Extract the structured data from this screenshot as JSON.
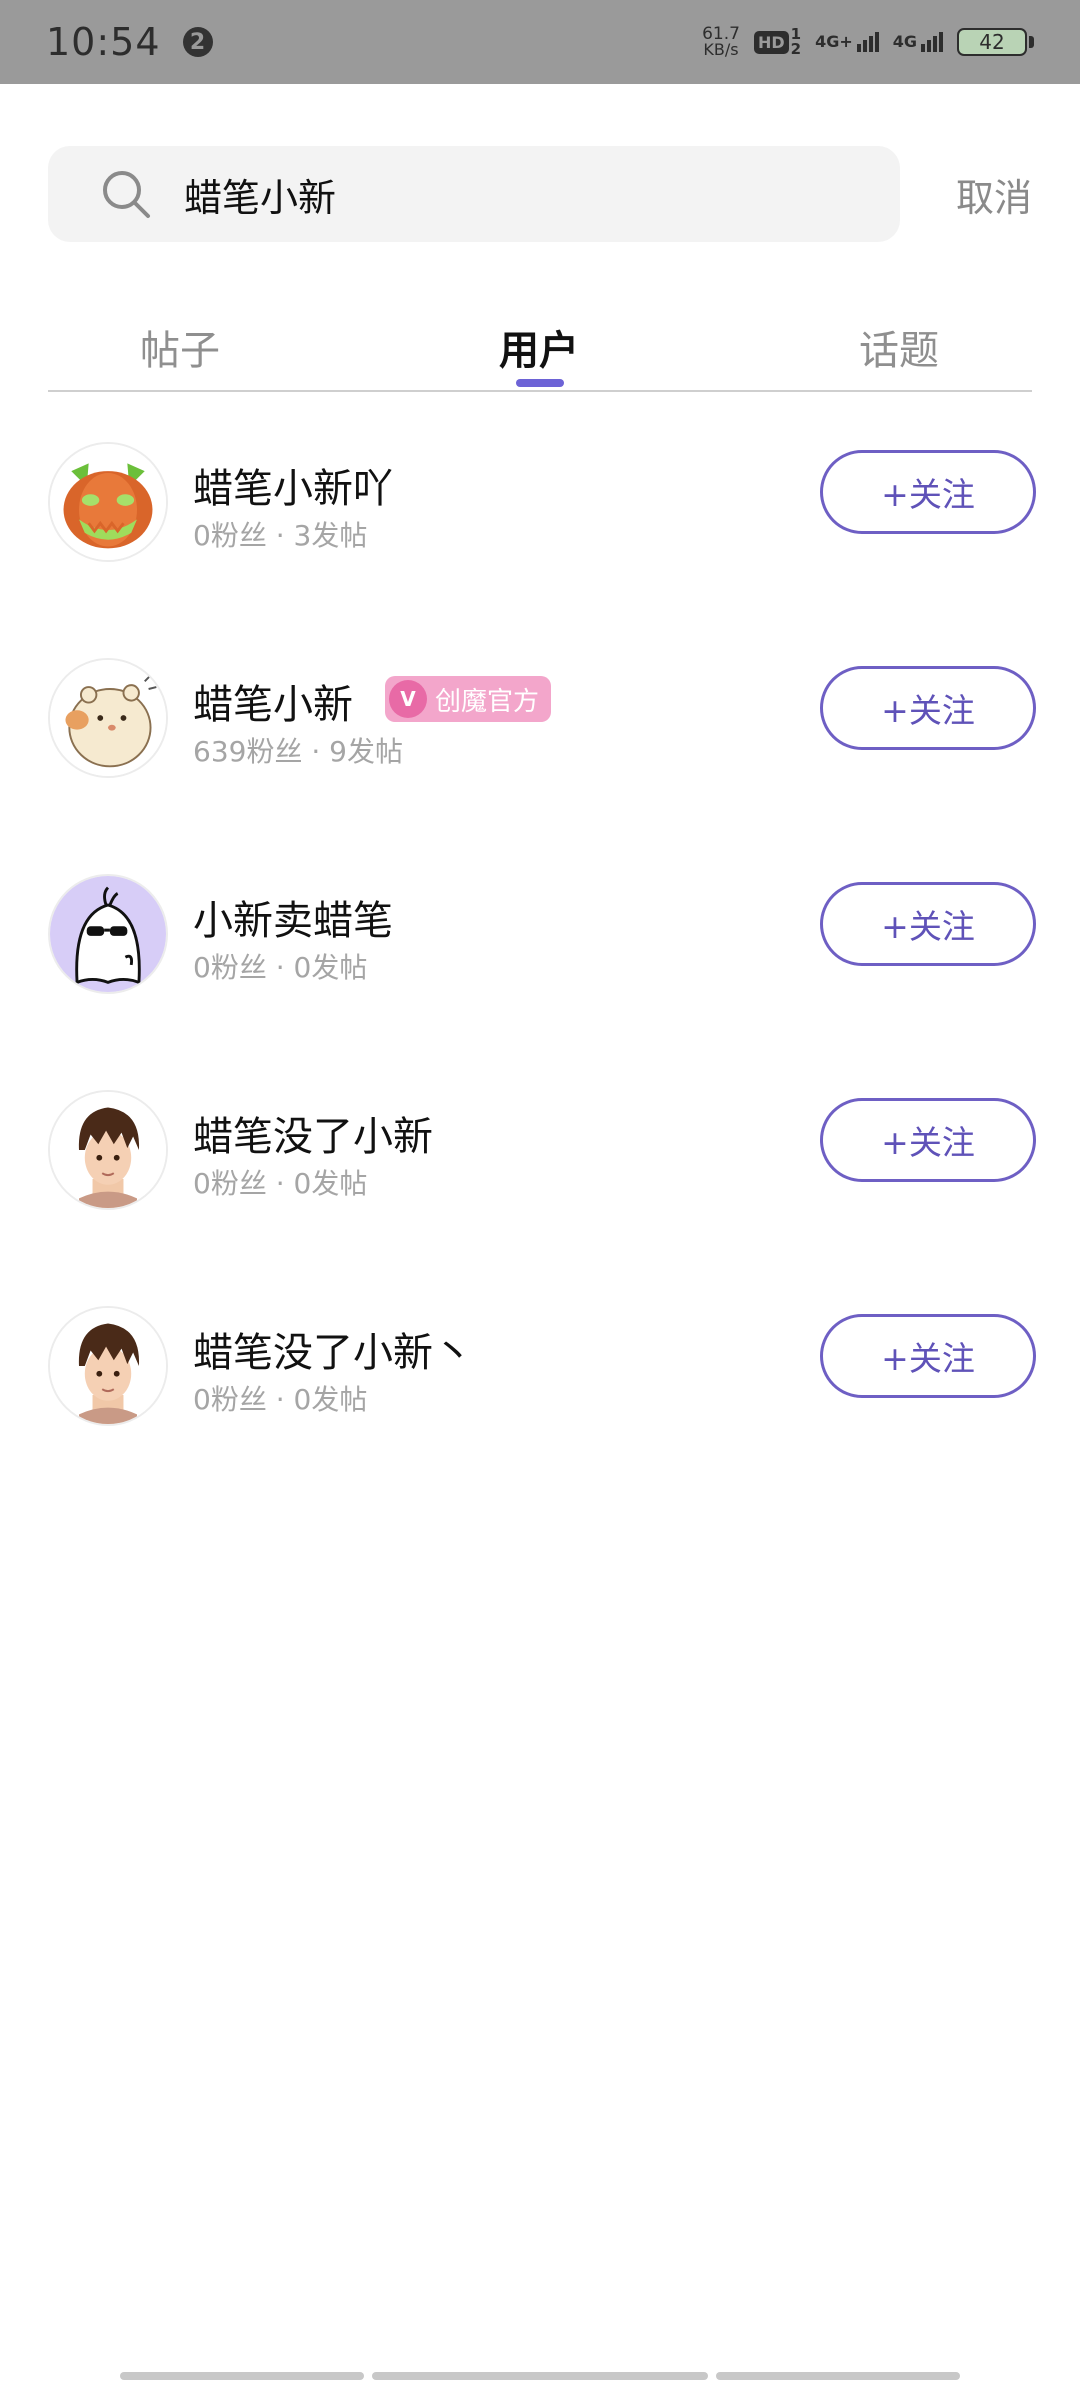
{
  "status_bar": {
    "time": "10:54",
    "notification_count": "2",
    "net_speed_value": "61.7",
    "net_speed_unit": "KB/s",
    "hd_label": "HD",
    "hd_sub_top": "1",
    "hd_sub_bottom": "2",
    "signal1_label": "4G+",
    "signal2_label": "4G",
    "battery": "42"
  },
  "search": {
    "query": "蜡笔小新",
    "cancel_label": "取消"
  },
  "tabs": [
    {
      "label": "帖子",
      "active": false
    },
    {
      "label": "用户",
      "active": true
    },
    {
      "label": "话题",
      "active": false
    }
  ],
  "users": [
    {
      "name": "蜡笔小新吖",
      "meta": "0粉丝 · 3发帖",
      "follow_label": "+关注"
    },
    {
      "name": "蜡笔小新",
      "meta": "639粉丝 · 9发帖",
      "follow_label": "+关注",
      "badge": "创魔官方",
      "badge_icon": "V"
    },
    {
      "name": "小新卖蜡笔",
      "meta": "0粉丝 · 0发帖",
      "follow_label": "+关注"
    },
    {
      "name": "蜡笔没了小新",
      "meta": "0粉丝 · 0发帖",
      "follow_label": "+关注"
    },
    {
      "name": "蜡笔没了小新丶",
      "meta": "0粉丝 · 0发帖",
      "follow_label": "+关注"
    }
  ],
  "colors": {
    "accent": "#6d63d6",
    "follow_border": "#6e5fc4",
    "badge_bg": "#f3a6cb",
    "status_bar_bg": "#9a9a9a"
  }
}
